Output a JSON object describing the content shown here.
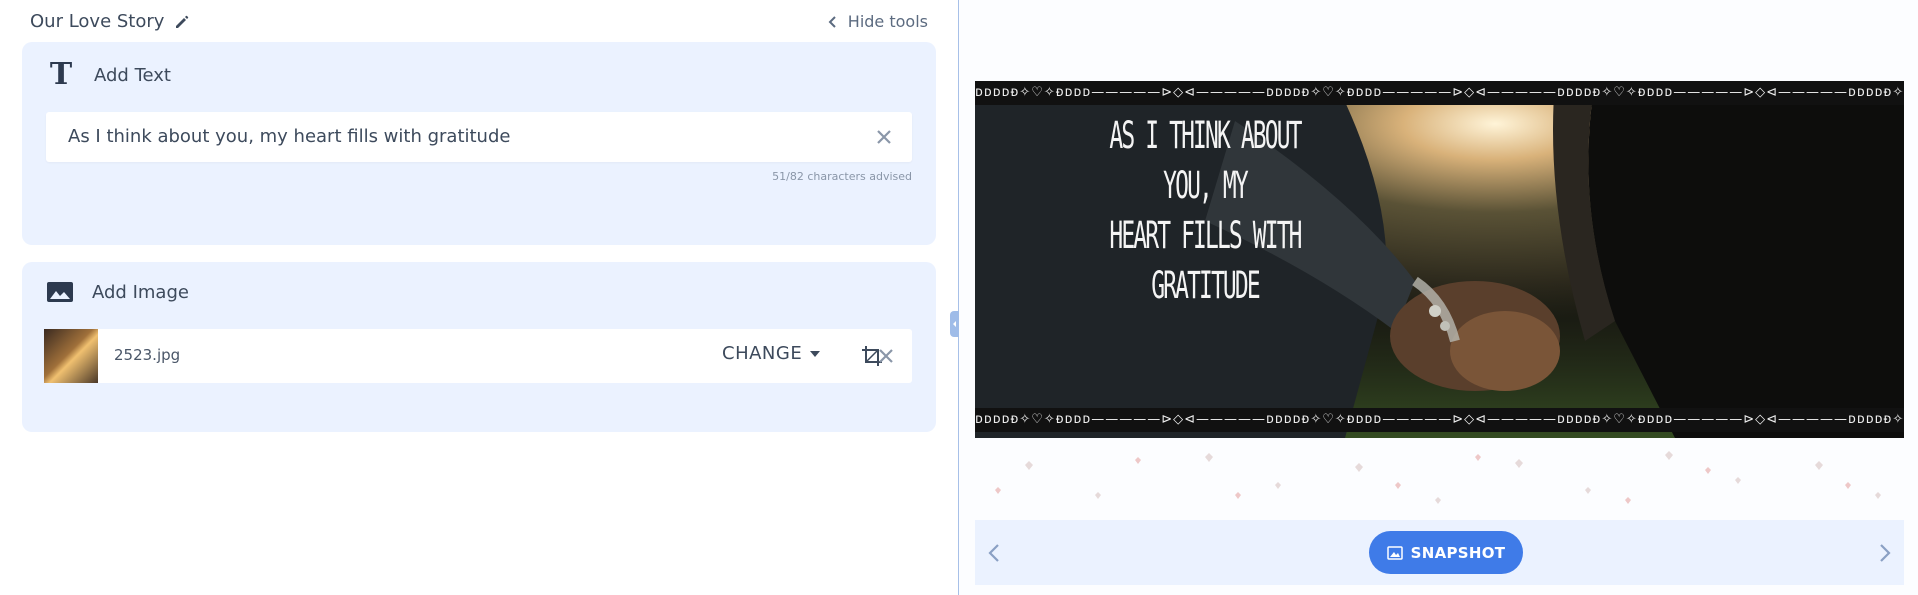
{
  "header": {
    "title": "Our Love Story",
    "hide_tools_label": "Hide tools"
  },
  "text_card": {
    "heading": "Add Text",
    "value": "As I think about you, my heart fills with gratitude",
    "char_count": "51/82 characters advised"
  },
  "image_card": {
    "heading": "Add Image",
    "file_name": "2523.jpg",
    "change_label": "CHANGE"
  },
  "preview": {
    "overlay_line1": "As I think about you, my",
    "overlay_line2": "heart fills with gratitude",
    "border_pattern": "ᴅᴅᴅᴅᴆ✧♡✧ᴆᴅᴅᴅ—————⊳◇⊲—————ᴅᴅᴅᴅᴆ✧♡✧ᴆᴅᴅᴅ—————⊳◇⊲—————ᴅᴅᴅᴅᴆ✧♡✧ᴆᴅᴅᴅ—————⊳◇⊲—————ᴅᴅᴅᴅᴆ✧♡✧ᴆᴅᴅᴅ—————⊳◇⊲—————ᴅᴅᴅᴅᴆ✧♡✧ᴆᴅᴅᴅ—————⊳◇⊲—————ᴅᴅᴅᴅᴆ✧♡✧ᴆᴅᴅᴅ"
  },
  "nav": {
    "snapshot_label": "SNAPSHOT"
  },
  "colors": {
    "accent": "#3f7be8",
    "card_bg": "#ebf2ff",
    "text": "#3d4a5c"
  }
}
